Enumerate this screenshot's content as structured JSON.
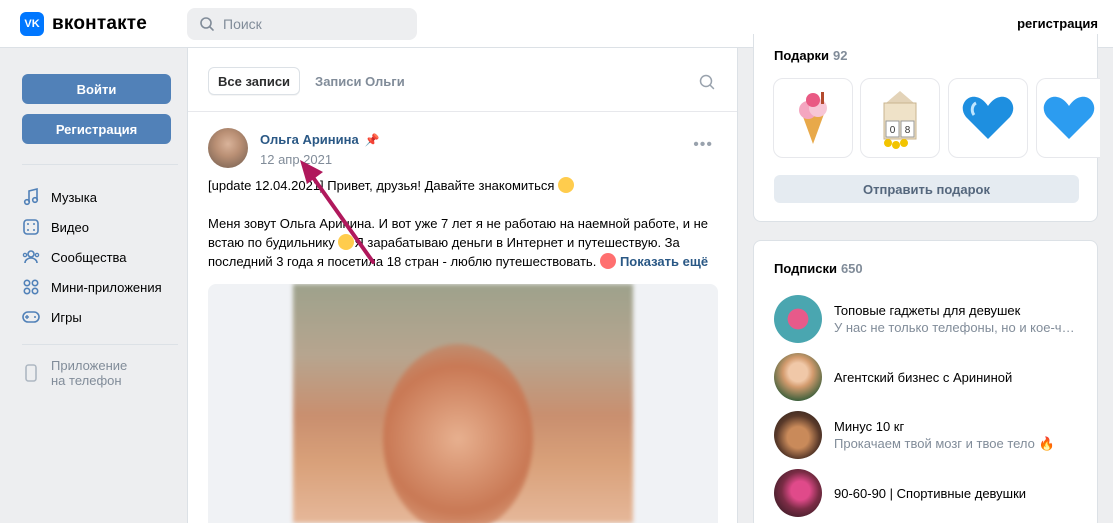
{
  "header": {
    "logo_mark": "VK",
    "logo_text": "вконтакте",
    "search_placeholder": "Поиск",
    "register_link": "регистрация"
  },
  "sidebar": {
    "login_button": "Войти",
    "register_button": "Регистрация",
    "items": [
      {
        "label": "Музыка",
        "icon": "music-icon"
      },
      {
        "label": "Видео",
        "icon": "video-icon"
      },
      {
        "label": "Сообщества",
        "icon": "communities-icon"
      },
      {
        "label": "Мини-приложения",
        "icon": "mini-apps-icon"
      },
      {
        "label": "Игры",
        "icon": "games-icon"
      }
    ],
    "app_line1": "Приложение",
    "app_line2": "на телефон"
  },
  "feed": {
    "tabs": [
      {
        "label": "Все записи",
        "active": true
      },
      {
        "label": "Записи Ольги",
        "active": false
      }
    ],
    "post": {
      "author": "Ольга Аринина",
      "date": "12 апр 2021",
      "line1": "[update 12.04.2021] Привет, друзья! Давайте знакомиться",
      "para2_a": "Меня зовут Ольга Аринина. И вот уже 7 лет я не работаю на наемной работе, и не встаю по будильнику",
      "para2_b": "Я зарабатываю деньги в Интернет и путешествую. За последний 3 года я посетила 18 стран - люблю путешествовать.",
      "show_more": "Показать ещё"
    }
  },
  "gifts": {
    "title": "Подарки",
    "count": "92",
    "send_button": "Отправить подарок"
  },
  "subscriptions": {
    "title": "Подписки",
    "count": "650",
    "items": [
      {
        "name": "Топовые гаджеты для девушек",
        "desc": "У нас не только телефоны, но и кое-что..."
      },
      {
        "name": "Агентский бизнес с Арининой",
        "desc": ""
      },
      {
        "name": "Минус 10 кг",
        "desc": "Прокачаем твой мозг и твое тело 🔥"
      },
      {
        "name": "90-60-90 | Спортивные девушки",
        "desc": ""
      }
    ]
  },
  "colors": {
    "brand": "#0077ff",
    "button": "#5181b8",
    "link": "#2a5885",
    "annotation_arrow": "#b0185c"
  }
}
